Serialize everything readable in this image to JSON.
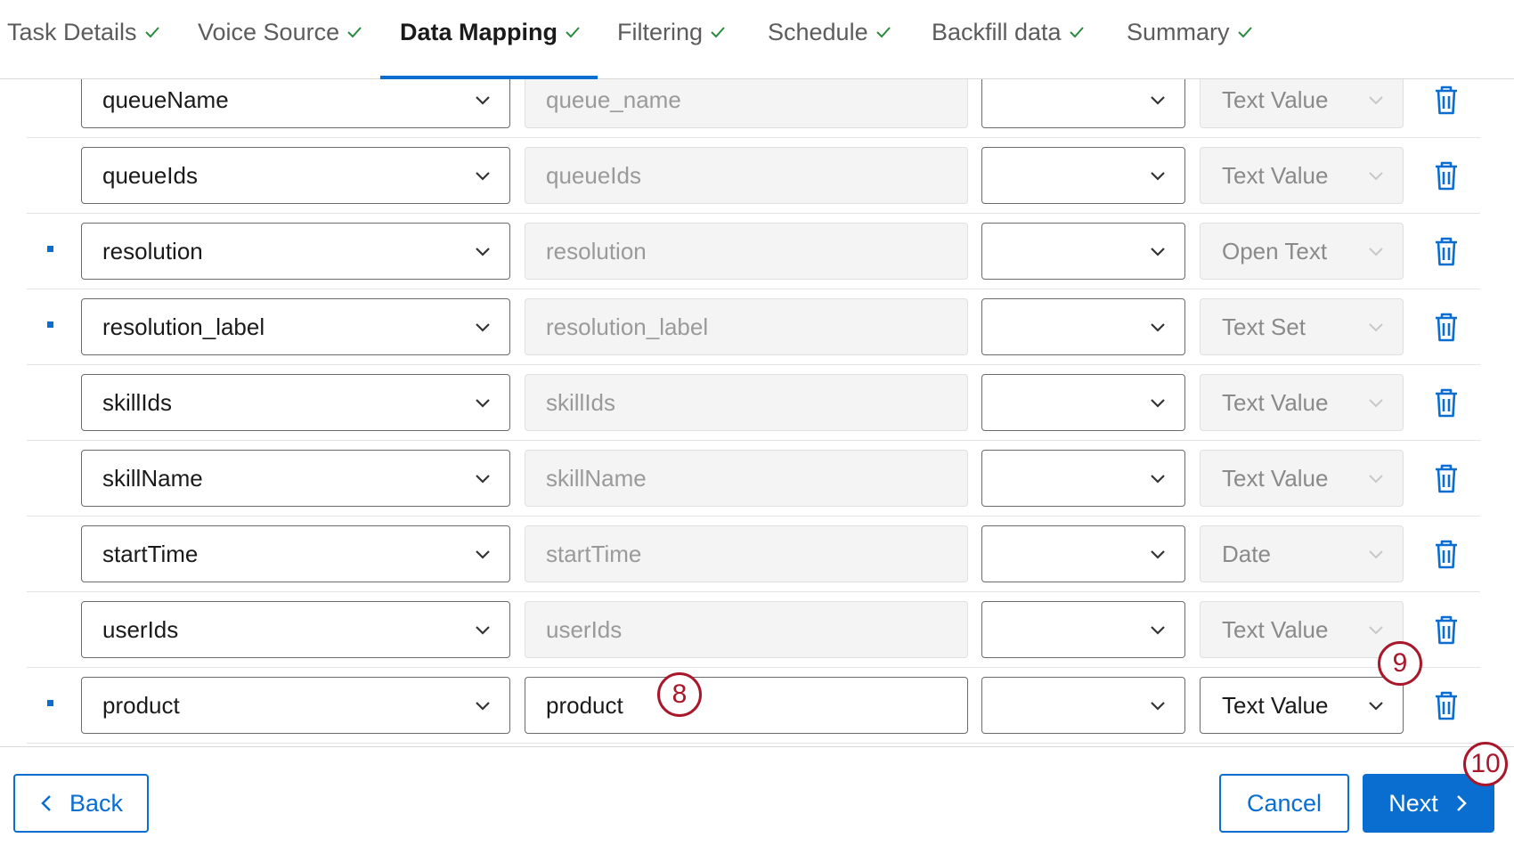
{
  "tabs": [
    {
      "label": "Task Details",
      "complete": true,
      "active": false
    },
    {
      "label": "Voice Source",
      "complete": true,
      "active": false
    },
    {
      "label": "Data Mapping",
      "complete": true,
      "active": true
    },
    {
      "label": "Filtering",
      "complete": true,
      "active": false
    },
    {
      "label": "Schedule",
      "complete": true,
      "active": false
    },
    {
      "label": "Backfill data",
      "complete": true,
      "active": false
    },
    {
      "label": "Summary",
      "complete": true,
      "active": false
    }
  ],
  "rows": [
    {
      "field": "queueName",
      "name": "queue_name",
      "type": "Text Value",
      "marked": false
    },
    {
      "field": "queueIds",
      "name": "queueIds",
      "type": "Text Value",
      "marked": false
    },
    {
      "field": "resolution",
      "name": "resolution",
      "type": "Open Text",
      "marked": true
    },
    {
      "field": "resolution_label",
      "name": "resolution_label",
      "type": "Text Set",
      "marked": true
    },
    {
      "field": "skillIds",
      "name": "skillIds",
      "type": "Text Value",
      "marked": false
    },
    {
      "field": "skillName",
      "name": "skillName",
      "type": "Text Value",
      "marked": false
    },
    {
      "field": "startTime",
      "name": "startTime",
      "type": "Date",
      "marked": false
    },
    {
      "field": "userIds",
      "name": "userIds",
      "type": "Text Value",
      "marked": false
    },
    {
      "field": "product",
      "name": "product",
      "type": "Text Value",
      "marked": true,
      "editable": true
    }
  ],
  "badges": {
    "name_field": "8",
    "type_field": "9",
    "next_button": "10"
  },
  "footer": {
    "back_label": "Back",
    "cancel_label": "Cancel",
    "next_label": "Next"
  },
  "colors": {
    "accent": "#0a6ed1",
    "check": "#2b8a3e",
    "badge": "#a8182a"
  }
}
